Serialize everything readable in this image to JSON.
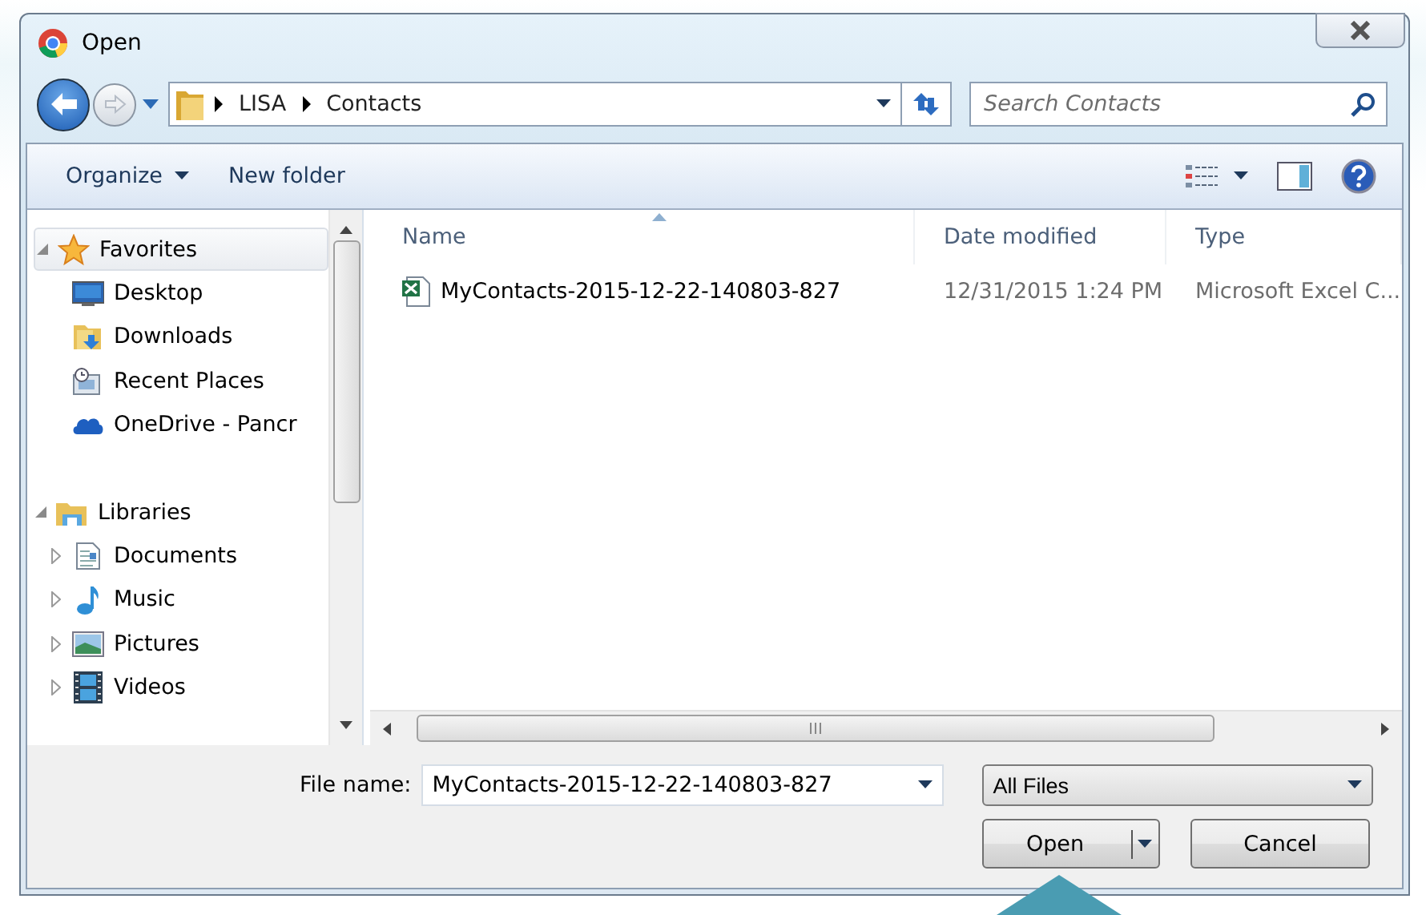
{
  "window": {
    "title": "Open"
  },
  "address": {
    "crumbs": [
      "LISA",
      "Contacts"
    ]
  },
  "search": {
    "placeholder": "Search Contacts"
  },
  "toolbar": [
    {
      "label": "Organize",
      "kind": "menu"
    },
    {
      "label": "New folder",
      "kind": "plain"
    }
  ],
  "nav": [
    {
      "label": "Favorites",
      "expanded": true,
      "selected": true,
      "children": [
        {
          "label": "Desktop",
          "selected": false
        },
        {
          "label": "Downloads",
          "selected": false
        },
        {
          "label": "Recent Places",
          "selected": false
        },
        {
          "label": "OneDrive - Pancr",
          "selected": false
        }
      ]
    },
    {
      "label": "Libraries",
      "expanded": true,
      "selected": false,
      "children": [
        {
          "label": "Documents",
          "expanded": false,
          "selected": false
        },
        {
          "label": "Music",
          "expanded": false,
          "selected": false
        },
        {
          "label": "Pictures",
          "expanded": false,
          "selected": false
        },
        {
          "label": "Videos",
          "expanded": false,
          "selected": false
        }
      ]
    }
  ],
  "columns": [
    {
      "label": "Name",
      "sorted": true
    },
    {
      "label": "Date modified",
      "sorted": false
    },
    {
      "label": "Type",
      "sorted": false
    }
  ],
  "files": [
    {
      "name": "MyContacts-2015-12-22-140803-827",
      "date": "12/31/2015 1:24 PM",
      "type": "Microsoft Excel C...",
      "selected": false
    }
  ],
  "file_name": {
    "label": "File name:",
    "value": "MyContacts-2015-12-22-140803-827"
  },
  "file_type": {
    "value": "All Files"
  },
  "buttons": [
    {
      "label": "Open",
      "kind": "split"
    },
    {
      "label": "Cancel",
      "kind": "plain"
    }
  ]
}
